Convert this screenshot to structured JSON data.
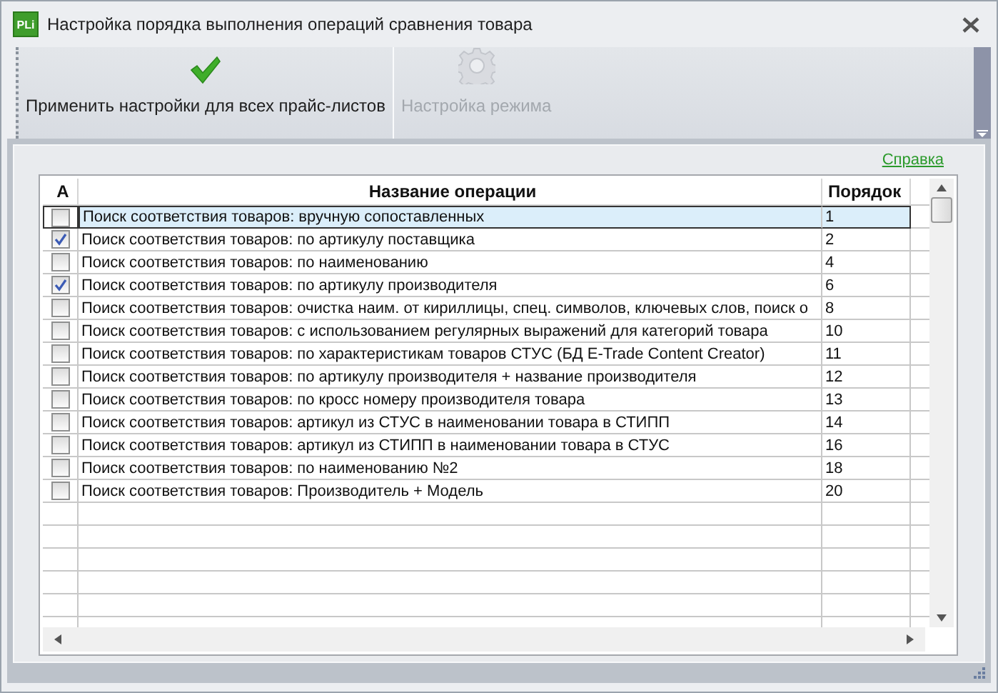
{
  "window": {
    "logo": "PLi",
    "title": "Настройка порядка выполнения операций сравнения товара"
  },
  "toolbar": {
    "buttons": [
      {
        "label": "Применить настройки для всех прайс-листов",
        "kind": "check",
        "disabled": false
      },
      {
        "label": "Настройка режима",
        "kind": "gear",
        "disabled": true
      }
    ]
  },
  "help_link": "Справка",
  "table": {
    "columns": [
      "A",
      "Название операции",
      "Порядок"
    ],
    "rows": [
      {
        "checked": false,
        "selected": true,
        "name": "Поиск соответствия товаров: вручную сопоставленных",
        "order": "1"
      },
      {
        "checked": true,
        "selected": false,
        "name": "Поиск соответствия товаров: по артикулу поставщика",
        "order": "2"
      },
      {
        "checked": false,
        "selected": false,
        "name": "Поиск соответствия товаров: по наименованию",
        "order": "4"
      },
      {
        "checked": true,
        "selected": false,
        "name": "Поиск соответствия товаров: по артикулу производителя",
        "order": "6"
      },
      {
        "checked": false,
        "selected": false,
        "name": "Поиск соответствия товаров: очистка наим. от кириллицы, спец. символов, ключевых слов, поиск о",
        "order": "8"
      },
      {
        "checked": false,
        "selected": false,
        "name": "Поиск соответствия товаров: с использованием регулярных выражений для категорий товара",
        "order": "10"
      },
      {
        "checked": false,
        "selected": false,
        "name": "Поиск соответствия товаров: по характеристикам товаров СТУС (БД E-Trade Content Creator)",
        "order": "11"
      },
      {
        "checked": false,
        "selected": false,
        "name": "Поиск соответствия товаров: по артикулу производителя + название производителя",
        "order": "12"
      },
      {
        "checked": false,
        "selected": false,
        "name": "Поиск соответствия товаров: по кросс номеру производителя товара",
        "order": "13"
      },
      {
        "checked": false,
        "selected": false,
        "name": "Поиск соответствия товаров: артикул из СТУС в наименовании товара в СТИПП",
        "order": "14"
      },
      {
        "checked": false,
        "selected": false,
        "name": "Поиск соответствия товаров: артикул из СТИПП в наименовании товара в СТУС",
        "order": "16"
      },
      {
        "checked": false,
        "selected": false,
        "name": "Поиск соответствия товаров: по наименованию №2",
        "order": "18"
      },
      {
        "checked": false,
        "selected": false,
        "name": "Поиск соответствия товаров: Производитель + Модель",
        "order": "20"
      }
    ]
  }
}
